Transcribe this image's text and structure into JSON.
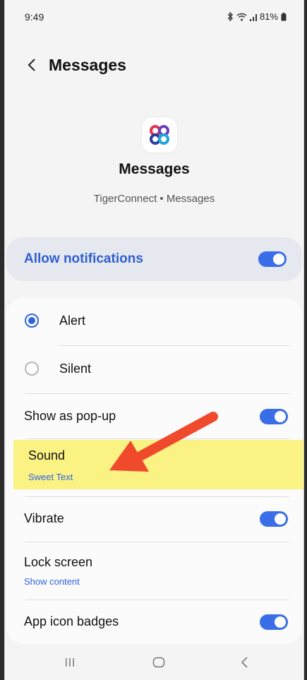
{
  "status_bar": {
    "time": "9:49",
    "battery": "81%"
  },
  "header": {
    "title": "Messages"
  },
  "app": {
    "name": "Messages",
    "subtitle": "TigerConnect • Messages"
  },
  "allow_notifications": {
    "label": "Allow notifications",
    "enabled": true
  },
  "settings": {
    "alert": {
      "label": "Alert",
      "selected": true
    },
    "silent": {
      "label": "Silent",
      "selected": false
    },
    "show_popup": {
      "label": "Show as pop-up",
      "enabled": true
    },
    "sound": {
      "label": "Sound",
      "value": "Sweet Text"
    },
    "vibrate": {
      "label": "Vibrate",
      "enabled": true
    },
    "lock_screen": {
      "label": "Lock screen",
      "value": "Show content"
    },
    "app_icon_badges": {
      "label": "App icon badges",
      "enabled": true
    }
  },
  "colors": {
    "accent": "#2f63e6",
    "highlight": "#fbf284",
    "annotation_arrow": "#f04a2c"
  },
  "icons": [
    "back-chevron-icon",
    "bluetooth-icon",
    "wifi-icon",
    "signal-icon",
    "battery-icon",
    "recents-icon",
    "home-icon",
    "nav-back-icon"
  ]
}
